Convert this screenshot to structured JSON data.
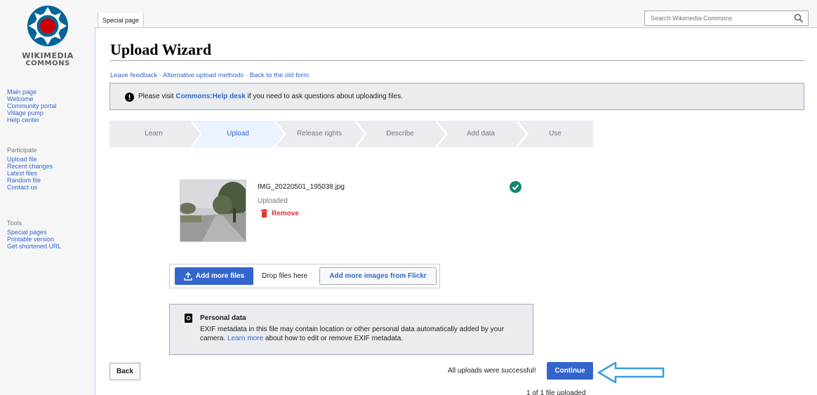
{
  "logo": {
    "line1": "WIKIMEDIA",
    "line2": "COMMONS"
  },
  "sidebar": {
    "main": [
      "Main page",
      "Welcome",
      "Community portal",
      "Village pump",
      "Help center"
    ],
    "participate_heading": "Participate",
    "participate": [
      "Upload file",
      "Recent changes",
      "Latest files",
      "Random file",
      "Contact us"
    ],
    "tools_heading": "Tools",
    "tools": [
      "Special pages",
      "Printable version",
      "Get shortened URL"
    ]
  },
  "tab": {
    "label": "Special page"
  },
  "search": {
    "placeholder": "Search Wikimedia Commons"
  },
  "page": {
    "title": "Upload Wizard",
    "links": [
      "Leave feedback",
      "Alternative upload methods",
      "Back to the old form"
    ],
    "link_separator": " · "
  },
  "notice": {
    "before": "Please visit ",
    "link": "Commons:Help desk",
    "after": " if you need to ask questions about uploading files."
  },
  "steps": [
    {
      "label": "Learn",
      "active": false
    },
    {
      "label": "Upload",
      "active": true
    },
    {
      "label": "Release rights",
      "active": false
    },
    {
      "label": "Describe",
      "active": false
    },
    {
      "label": "Add data",
      "active": false
    },
    {
      "label": "Use",
      "active": false
    }
  ],
  "file": {
    "name": "IMG_20220501_195038.jpg",
    "status": "Uploaded",
    "remove_label": "Remove"
  },
  "add_files": {
    "add_more_label": "Add more files",
    "drop_label": "Drop files here",
    "flickr_label": "Add more images from Flickr"
  },
  "personal_data": {
    "title": "Personal data",
    "body_before": "EXIF metadata in this file may contain location or other personal data automatically added by your camera. ",
    "link": "Learn more",
    "body_after": " about how to edit or remove EXIF metadata."
  },
  "footer": {
    "back_label": "Back",
    "success_text": "All uploads were successful!",
    "continue_label": "Continue",
    "count_text": "1 of 1 file uploaded"
  },
  "colors": {
    "link": "#3366cc",
    "primary_button": "#3366cc",
    "success": "#14866d",
    "destructive": "#d33",
    "annotation_arrow": "#3a9bdc"
  }
}
